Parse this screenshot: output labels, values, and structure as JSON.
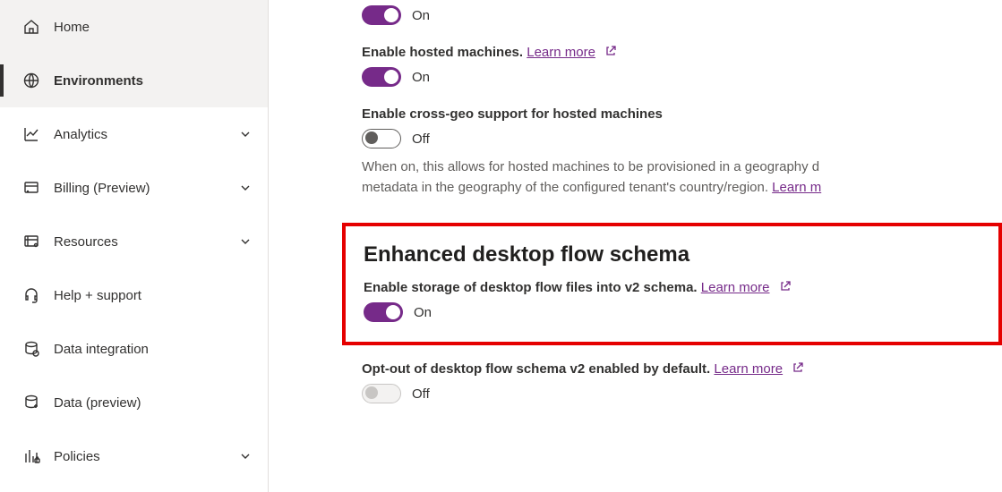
{
  "sidebar": {
    "items": [
      {
        "label": "Home"
      },
      {
        "label": "Environments"
      },
      {
        "label": "Analytics"
      },
      {
        "label": "Billing (Preview)"
      },
      {
        "label": "Resources"
      },
      {
        "label": "Help + support"
      },
      {
        "label": "Data integration"
      },
      {
        "label": "Data (preview)"
      },
      {
        "label": "Policies"
      }
    ]
  },
  "settings": {
    "initial_toggle_state": "On",
    "hosted_machines": {
      "label_prefix": "Enable hosted machines.",
      "learn": "Learn more",
      "state": "On"
    },
    "cross_geo": {
      "label": "Enable cross-geo support for hosted machines",
      "state": "Off",
      "desc_prefix": "When on, this allows for hosted machines to be provisioned in a geography d",
      "desc_suffix": "metadata in the geography of the configured tenant's country/region.",
      "learn": "Learn m"
    },
    "enhanced_schema": {
      "heading": "Enhanced desktop flow schema",
      "enable_label": "Enable storage of desktop flow files into v2 schema.",
      "learn": "Learn more",
      "enable_state": "On"
    },
    "optout": {
      "label": "Opt-out of desktop flow schema v2 enabled by default.",
      "learn": "Learn more",
      "state": "Off"
    }
  },
  "colors": {
    "accent": "#762a89",
    "highlight": "#e50000"
  }
}
